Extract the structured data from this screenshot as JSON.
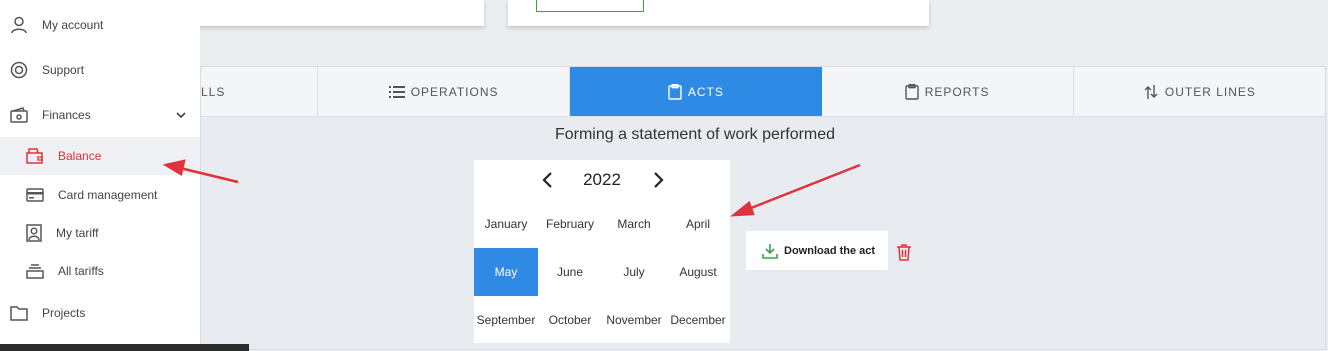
{
  "sidebar": {
    "items": [
      {
        "label": "My account",
        "icon": "user-icon"
      },
      {
        "label": "Support",
        "icon": "lifebuoy-icon"
      },
      {
        "label": "Finances",
        "icon": "wallet-icon"
      },
      {
        "label": "Balance",
        "icon": "balance-icon"
      },
      {
        "label": "Card management",
        "icon": "card-icon"
      },
      {
        "label": "My tariff",
        "icon": "portrait-icon"
      },
      {
        "label": "All tariffs",
        "icon": "stack-icon"
      },
      {
        "label": "Projects",
        "icon": "folder-icon"
      }
    ]
  },
  "tabs": [
    {
      "label": "LLS",
      "icon": ""
    },
    {
      "label": "OPERATIONS",
      "icon": "list-icon"
    },
    {
      "label": "ACTS",
      "icon": "clipboard-icon"
    },
    {
      "label": "REPORTS",
      "icon": "clipboard-icon"
    },
    {
      "label": "OUTER LINES",
      "icon": "swap-arrows-icon"
    }
  ],
  "active_tab": "ACTS",
  "statement": {
    "title": "Forming a statement of work performed",
    "year": "2022",
    "months": [
      "January",
      "February",
      "March",
      "April",
      "May",
      "June",
      "July",
      "August",
      "September",
      "October",
      "November",
      "December"
    ],
    "selected_month": "May",
    "download_label": "Download the act"
  },
  "colors": {
    "accent": "#2f8ae5",
    "danger": "#e0323c",
    "download_icon": "#3aa34a"
  }
}
